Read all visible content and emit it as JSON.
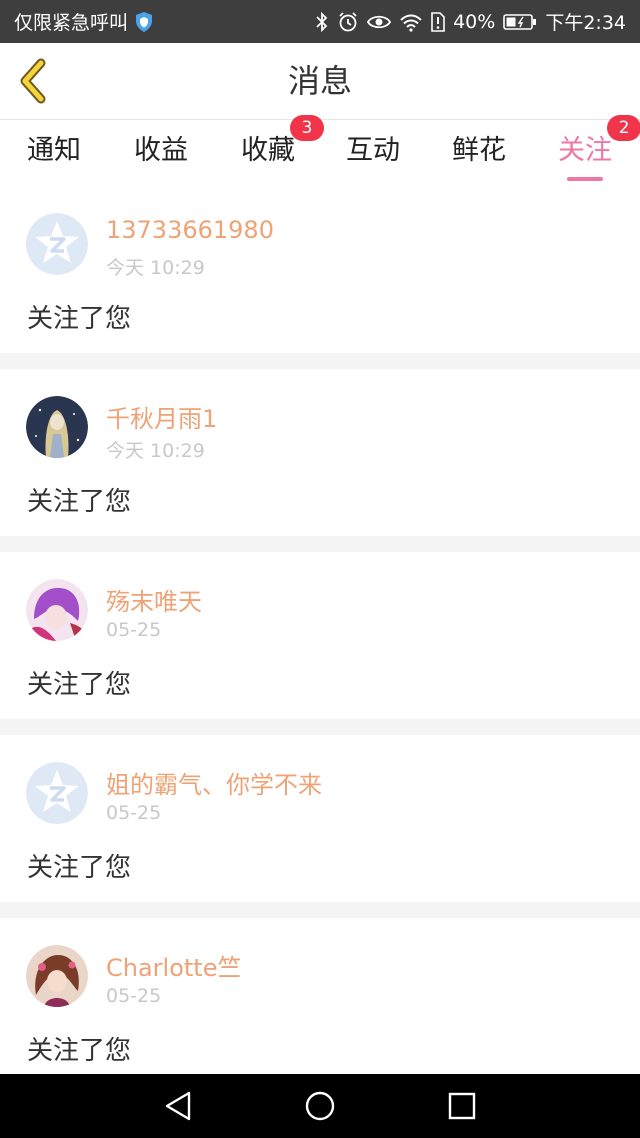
{
  "status_bar": {
    "left_text": "仅限紧急呼叫",
    "battery": "40%",
    "time": "下午2:34",
    "icons": [
      "shield-icon",
      "bluetooth-icon",
      "alarm-icon",
      "eye-icon",
      "wifi-icon",
      "sim-alert-icon",
      "battery-icon"
    ]
  },
  "header": {
    "title": "消息",
    "back_icon": "chevron-left-icon"
  },
  "tabs": [
    {
      "label": "通知",
      "badge": ""
    },
    {
      "label": "收益",
      "badge": ""
    },
    {
      "label": "收藏",
      "badge": "3"
    },
    {
      "label": "互动",
      "badge": ""
    },
    {
      "label": "鲜花",
      "badge": ""
    },
    {
      "label": "关注",
      "badge": "2",
      "active": true
    }
  ],
  "colors": {
    "accent_pink": "#ef77a6",
    "username_orange": "#eea377",
    "badge_red": "#f0344a",
    "status_bar_bg": "#3e3e3e"
  },
  "messages": [
    {
      "username": "13733661980",
      "time": "今天 10:29",
      "text": "关注了您",
      "avatar": "default-avatar-icon"
    },
    {
      "username": "千秋月雨1",
      "time": "今天 10:29",
      "text": "关注了您",
      "avatar": "user-avatar-image"
    },
    {
      "username": "殇末唯天",
      "time": "05-25",
      "text": "关注了您",
      "avatar": "user-avatar-image"
    },
    {
      "username": "姐的霸气、你学不来",
      "time": "05-25",
      "text": "关注了您",
      "avatar": "default-avatar-icon"
    },
    {
      "username": "Charlotte竺",
      "time": "05-25",
      "text": "关注了您",
      "avatar": "user-avatar-image"
    }
  ],
  "nav_bar": {
    "icons": [
      "back-triangle-icon",
      "home-circle-icon",
      "recents-square-icon"
    ]
  }
}
